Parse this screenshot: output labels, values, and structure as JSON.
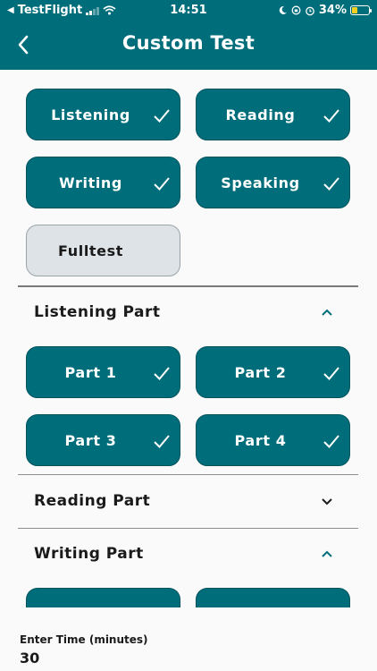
{
  "status_bar": {
    "carrier": "TestFlight",
    "time": "14:51",
    "battery": "34%"
  },
  "header": {
    "title": "Custom Test"
  },
  "skills": [
    {
      "label": "Listening",
      "selected": true
    },
    {
      "label": "Reading",
      "selected": true
    },
    {
      "label": "Writing",
      "selected": true
    },
    {
      "label": "Speaking",
      "selected": true
    },
    {
      "label": "Fulltest",
      "selected": false
    }
  ],
  "sections": {
    "listening": {
      "title": "Listening Part",
      "expanded": true,
      "parts": [
        "Part 1",
        "Part 2",
        "Part 3",
        "Part 4"
      ]
    },
    "reading": {
      "title": "Reading Part",
      "expanded": false
    },
    "writing": {
      "title": "Writing Part",
      "expanded": true
    }
  },
  "time": {
    "label": "Enter Time (minutes)",
    "value": "30"
  },
  "colors": {
    "accent": "#006d7a",
    "tile_off": "#dde3e6",
    "battery": "#f5d020"
  }
}
